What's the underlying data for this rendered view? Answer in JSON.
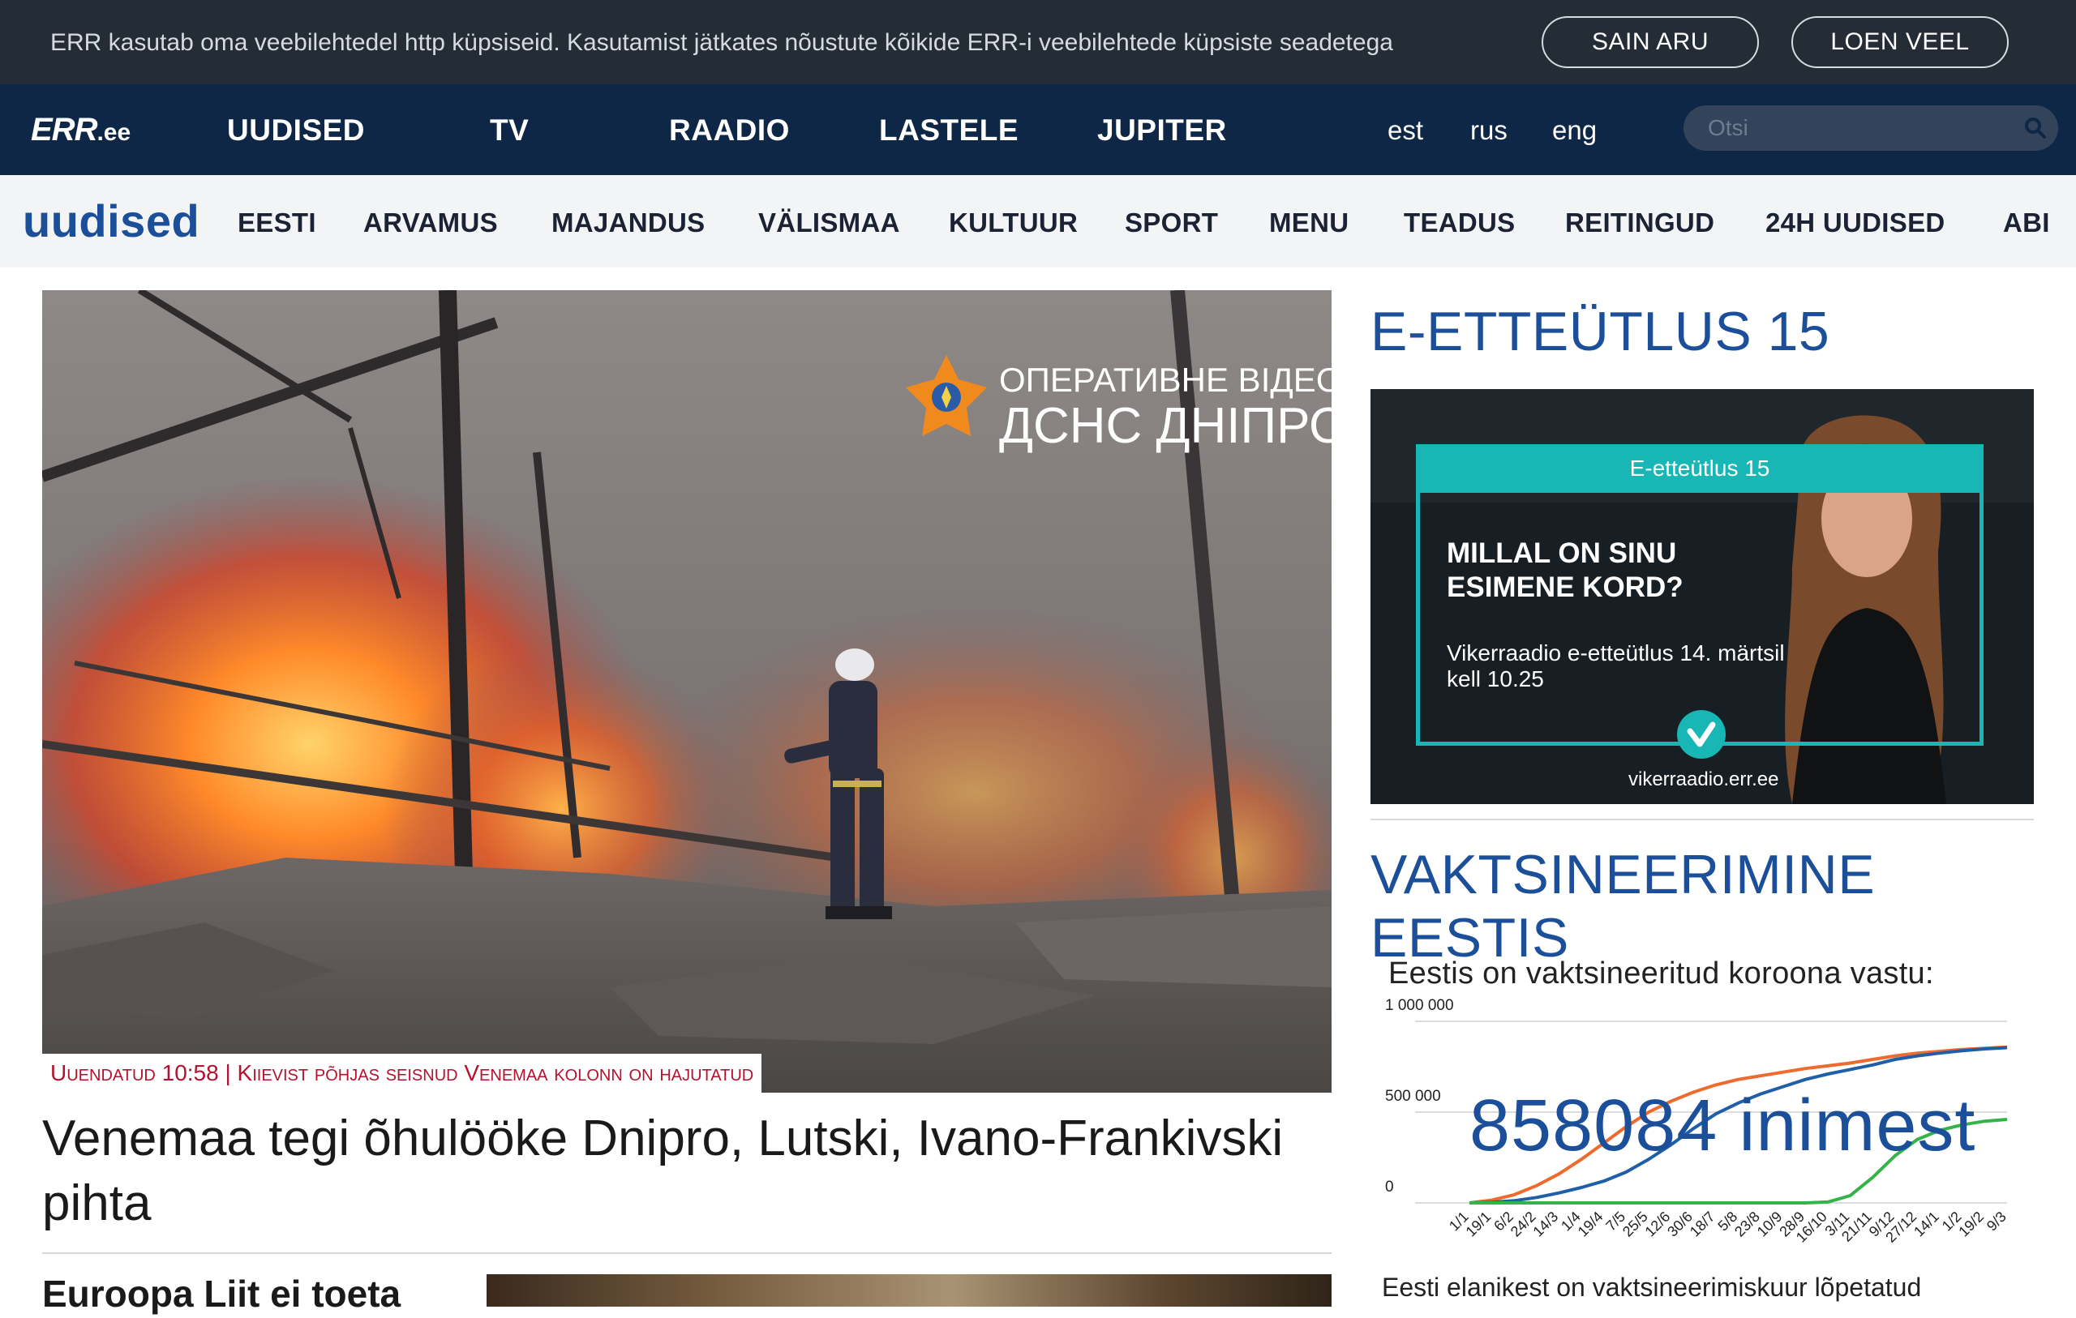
{
  "cookie_bar": {
    "text": "ERR kasutab oma veebilehtedel http küpsiseid. Kasutamist jätkates nõustute kõikide ERR-i veebilehtede küpsiste seadetega",
    "agree_label": "SAIN ARU",
    "more_label": "LOEN VEEL"
  },
  "header": {
    "logo_main": "ERR",
    "logo_suffix": ".ee",
    "nav": [
      "UUDISED",
      "TV",
      "RAADIO",
      "LASTELE",
      "JUPITER"
    ],
    "languages": [
      "est",
      "rus",
      "eng"
    ],
    "search_placeholder": "Otsi"
  },
  "subnav": {
    "brand": "uudised",
    "items": [
      "EESTI",
      "ARVAMUS",
      "MAJANDUS",
      "VÄLISMAA",
      "KULTUUR",
      "SPORT",
      "MENU",
      "TEADUS",
      "REITINGUD",
      "24H UUDISED",
      "ABI"
    ]
  },
  "main": {
    "hero_image_text": [
      "ОПЕРАТИВНЕ ВІДЕО",
      "ДСНС ДНІПРО"
    ],
    "caption": "Uuendatud 10:58 | Kiievist põhjas seisnud Venemaa kolonn on hajutatud",
    "headline": "Venemaa tegi õhulööke Dnipro, Lutski, Ivano-Frankivski pihta",
    "second_headline": "Euroopa Liit ei toeta"
  },
  "sidebar": {
    "promo_title": "E-ETTEÜTLUS 15",
    "ad": {
      "tab": "E-etteütlus 15",
      "question": "MILLAL ON SINU ESIMENE KORD?",
      "subtitle": "Vikerraadio e-etteütlus 14. märtsil kell 10.25",
      "url": "vikerraadio.err.ee"
    },
    "vacc_title": "VAKTSINEERIMINE EESTIS",
    "vacc_lead": "Eestis on vaktsineeritud koroona vastu:",
    "vacc_count": "858084 inimest",
    "vacc_foot": "Eesti elanikest on vaktsineerimiskuur lõpetatud"
  },
  "chart_data": {
    "type": "line",
    "x": [
      "1/1",
      "19/1",
      "6/2",
      "24/2",
      "14/3",
      "1/4",
      "19/4",
      "7/5",
      "25/5",
      "12/6",
      "30/6",
      "18/7",
      "5/8",
      "23/8",
      "10/9",
      "28/9",
      "16/10",
      "3/11",
      "21/11",
      "9/12",
      "27/12",
      "14/1",
      "1/2",
      "19/2",
      "9/3"
    ],
    "ylim": [
      0,
      1000000
    ],
    "yticks": [
      "1 000 000",
      "500 000",
      "0"
    ],
    "series": [
      {
        "color": "#ee6a2e",
        "values": [
          0,
          15000,
          45000,
          95000,
          160000,
          240000,
          330000,
          420000,
          500000,
          560000,
          610000,
          650000,
          680000,
          700000,
          720000,
          740000,
          755000,
          770000,
          790000,
          810000,
          825000,
          835000,
          845000,
          852000,
          858000
        ]
      },
      {
        "color": "#1f5fa8",
        "values": [
          0,
          3000,
          12000,
          30000,
          55000,
          85000,
          120000,
          170000,
          240000,
          320000,
          410000,
          490000,
          550000,
          600000,
          640000,
          680000,
          710000,
          735000,
          760000,
          790000,
          810000,
          825000,
          838000,
          848000,
          855000
        ]
      },
      {
        "color": "#34b34a",
        "values": [
          0,
          0,
          0,
          0,
          0,
          0,
          0,
          0,
          0,
          0,
          0,
          0,
          0,
          0,
          0,
          0,
          5000,
          40000,
          140000,
          260000,
          350000,
          400000,
          430000,
          450000,
          460000
        ]
      }
    ]
  },
  "colors": {
    "cookie_bg": "#242c35",
    "nav_bg": "#0e2746",
    "brand_blue": "#1b4f9a",
    "caption_red": "#b4122e",
    "ad_teal": "#18b6b4"
  }
}
